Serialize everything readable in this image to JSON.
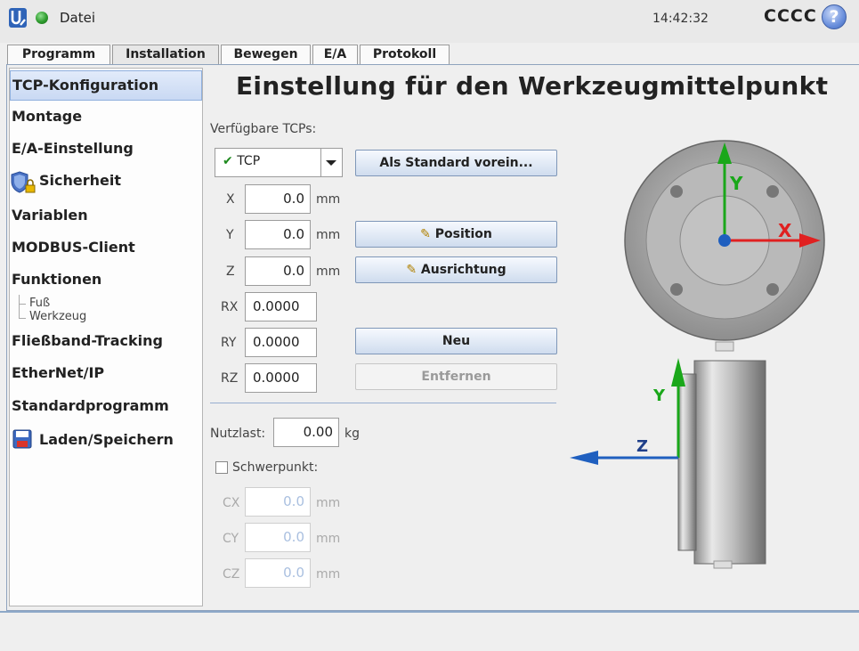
{
  "topbar": {
    "file_menu": "Datei",
    "time": "14:42:32",
    "robot_name": "CCCC",
    "help": "?"
  },
  "tabs": [
    {
      "label": "Programm"
    },
    {
      "label": "Installation",
      "active": true
    },
    {
      "label": "Bewegen"
    },
    {
      "label": "E/A"
    },
    {
      "label": "Protokoll"
    }
  ],
  "sidebar": {
    "items": [
      {
        "label": "TCP-Konfiguration",
        "selected": true
      },
      {
        "label": "Montage"
      },
      {
        "label": "E/A-Einstellung"
      },
      {
        "label": "Sicherheit",
        "icon": "shield-lock-icon"
      },
      {
        "label": "Variablen"
      },
      {
        "label": "MODBUS-Client"
      },
      {
        "label": "Funktionen"
      },
      {
        "label": "Fließband-Tracking"
      },
      {
        "label": "EtherNet/IP"
      },
      {
        "label": "Standardprogramm"
      },
      {
        "label": "Laden/Speichern",
        "icon": "floppy-disk-icon"
      }
    ],
    "sub_items": [
      "Fuß",
      "Werkzeug"
    ]
  },
  "content": {
    "title": "Einstellung für den Werkzeugmittelpunkt",
    "available_label": "Verfügbare TCPs:",
    "selected_tcp": "TCP",
    "set_default_button": "Als Standard vorein...",
    "position_button": "Position",
    "orientation_button": "Ausrichtung",
    "new_button": "Neu",
    "remove_button": "Entfernen",
    "fields": {
      "x": {
        "label": "X",
        "value": "0.0",
        "unit": "mm"
      },
      "y": {
        "label": "Y",
        "value": "0.0",
        "unit": "mm"
      },
      "z": {
        "label": "Z",
        "value": "0.0",
        "unit": "mm"
      },
      "rx": {
        "label": "RX",
        "value": "0.0000"
      },
      "ry": {
        "label": "RY",
        "value": "0.0000"
      },
      "rz": {
        "label": "RZ",
        "value": "0.0000"
      }
    },
    "payload": {
      "label": "Nutzlast:",
      "value": "0.00",
      "unit": "kg"
    },
    "cog": {
      "label": "Schwerpunkt:",
      "checked": false,
      "cx": {
        "label": "CX",
        "value": "0.0",
        "unit": "mm"
      },
      "cy": {
        "label": "CY",
        "value": "0.0",
        "unit": "mm"
      },
      "cz": {
        "label": "CZ",
        "value": "0.0",
        "unit": "mm"
      }
    },
    "diagram": {
      "top_axis_x": "X",
      "top_axis_y": "Y",
      "side_axis_y": "Y",
      "side_axis_z": "Z",
      "colors": {
        "x": "#e02020",
        "y": "#1aa71a",
        "z": "#1f5fbf"
      }
    }
  }
}
